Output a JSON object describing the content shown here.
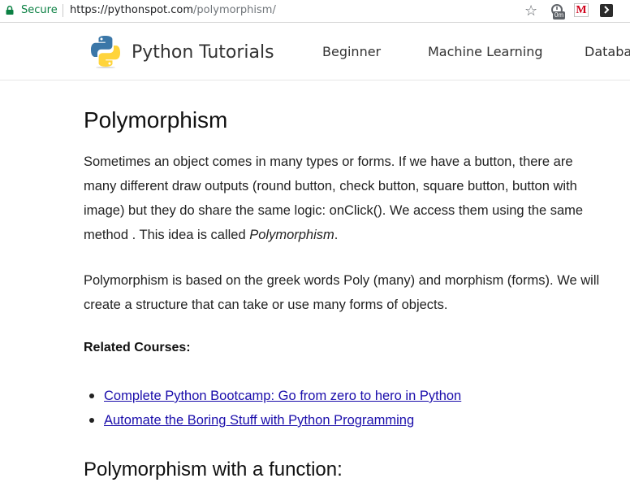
{
  "browser": {
    "secure_label": "Secure",
    "url_host": "https://pythonspot.com",
    "url_path": "/polymorphism/",
    "extension_badge": "0m",
    "extension_m": "M",
    "icons": [
      "lock-icon",
      "star-icon",
      "timer-extension-icon",
      "m-extension-icon",
      "k-extension-icon"
    ]
  },
  "header": {
    "site_title": "Python Tutorials",
    "nav": [
      "Beginner",
      "Machine Learning",
      "Databas"
    ]
  },
  "article": {
    "title": "Polymorphism",
    "para1_text": "Sometimes an object comes in many types or forms. If we have a button, there are many different draw outputs (round button, check button, square button, button with image) but they do share the same logic: onClick().  We access them using the same method . This idea is called ",
    "para1_em": "Polymorphism",
    "para1_end": ".",
    "para2": "Polymorphism is based on the greek words Poly (many) and morphism (forms).  We will create a structure that can take or use many forms of objects.",
    "related_heading": "Related Courses:",
    "courses": [
      "Complete Python Bootcamp: Go from zero to hero in Python",
      "Automate the Boring Stuff with Python Programming"
    ],
    "subheading": "Polymorphism with a function:"
  },
  "colors": {
    "secure_green": "#0b8043",
    "link_blue": "#1a0dab",
    "python_blue": "#3b77a8",
    "python_yellow": "#ffd43b"
  }
}
